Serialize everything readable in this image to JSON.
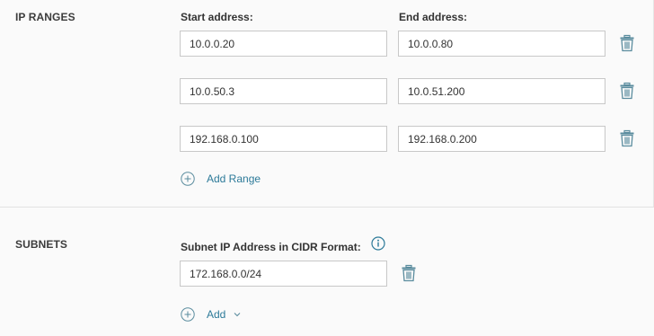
{
  "ip_ranges": {
    "title": "IP RANGES",
    "start_header": "Start address:",
    "end_header": "End address:",
    "rows": [
      {
        "start": "10.0.0.20",
        "end": "10.0.0.80"
      },
      {
        "start": "10.0.50.3",
        "end": "10.0.51.200"
      },
      {
        "start": "192.168.0.100",
        "end": "192.168.0.200"
      }
    ],
    "add_label": "Add Range"
  },
  "subnets": {
    "title": "SUBNETS",
    "header": "Subnet IP Address in CIDR Format:",
    "rows": [
      {
        "value": "172.168.0.0/24"
      }
    ],
    "add_label": "Add"
  },
  "icons": {
    "delete": "trash-icon",
    "add": "plus-circle-icon",
    "info": "info-icon",
    "dropdown": "chevron-down-icon"
  },
  "colors": {
    "accent": "#2c7a99",
    "background": "#fafafa",
    "field_border": "#c8c8c8"
  }
}
